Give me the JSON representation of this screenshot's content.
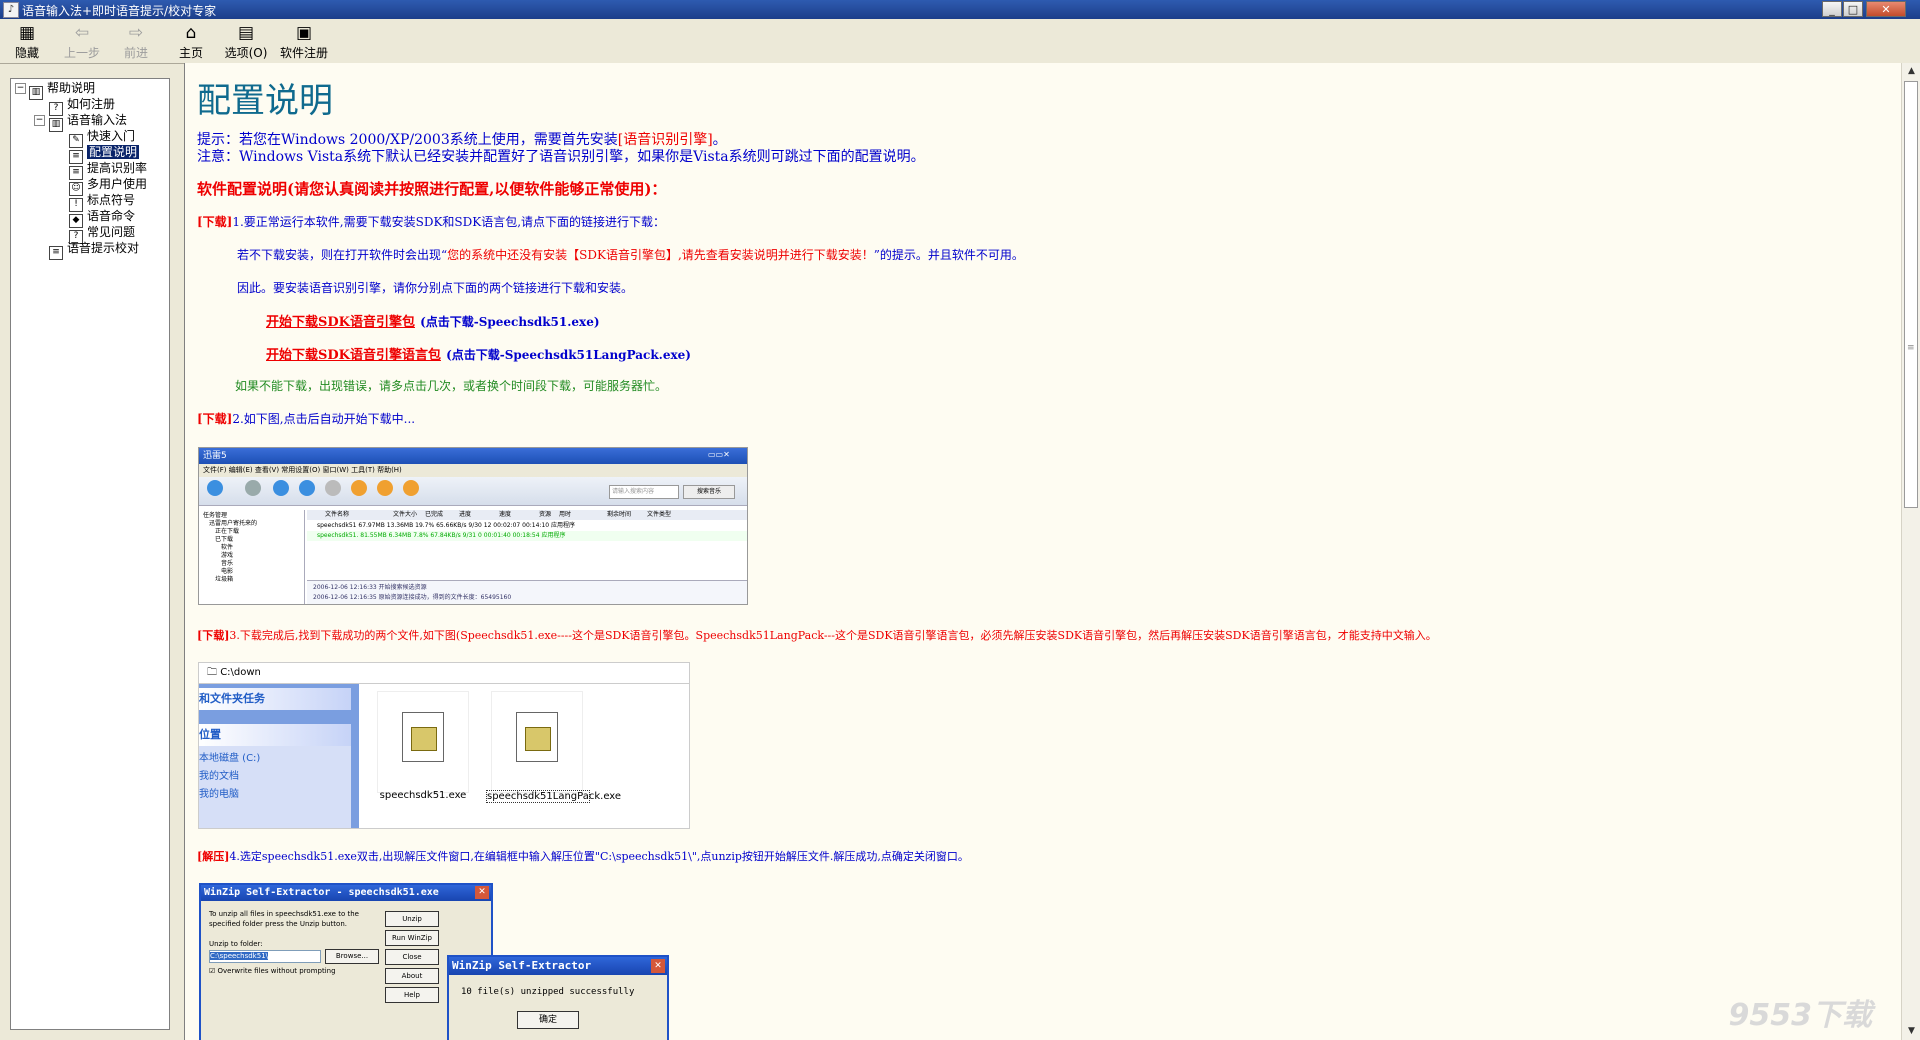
{
  "window": {
    "title": "语音输入法+即时语音提示/校对专家",
    "minimize": "_",
    "maximize": "□",
    "close": "✕"
  },
  "toolbar": {
    "hide": "隐藏",
    "back": "上一步",
    "forward": "前进",
    "home": "主页",
    "options": "选项(O)",
    "register": "软件注册"
  },
  "tree": {
    "root": "帮助说明",
    "howto_register": "如何注册",
    "voice_input": "语音输入法",
    "quick_start": "快速入门",
    "config": "配置说明",
    "improve": "提高识别率",
    "multiuser": "多用户使用",
    "punct": "标点符号",
    "commands": "语音命令",
    "faq": "常见问题",
    "proof": "语音提示校对"
  },
  "content": {
    "heading": "配置说明",
    "tip1_prefix": "提示：若您在Windows 2000/XP/2003系统上使用，需要首先安装",
    "tip1_link": "[语音识别引擎]",
    "tip1_suffix": "。",
    "tip2": "注意：Windows Vista系统下默认已经安装并配置好了语音识别引擎，如果你是Vista系统则可跳过下面的配置说明。",
    "section_title": "软件配置说明(请您认真阅读并按照进行配置,以便软件能够正常使用)：",
    "step1_tag": "[下载]",
    "step1_text": "1.要正常运行本软件,需要下载安装SDK和SDK语言包,请点下面的链接进行下载：",
    "step1_note_a": "若不下载安装，则在打开软件时会出现“",
    "step1_note_red": "您的系统中还没有安装【SDK语音引擎包】,请先查看安装说明并进行下载安装！",
    "step1_note_b": "”的提示。并且软件不可用。",
    "step1_note2": "因此。要安装语音识别引擎，请你分别点下面的两个链接进行下载和安装。",
    "link1": "开始下载SDK语音引擎包",
    "link1_hint": "(点击下载-Speechsdk51.exe)",
    "link2": "开始下载SDK语音引擎语言包",
    "link2_hint": "(点击下载-Speechsdk51LangPack.exe)",
    "retry_note": "如果不能下载，出现错误，请多点击几次，或者换个时间段下载，可能服务器忙。",
    "step2_tag": "[下载]",
    "step2_text": "2.如下图,点击后自动开始下载中...",
    "step3_tag": "[下载]",
    "step3_text": "3.下载完成后,找到下载成功的两个文件,如下图(Speechsdk51.exe----这个是SDK语音引擎包。Speechsdk51LangPack---这个是SDK语音引擎语言包，必须先解压安装SDK语音引擎包，然后再解压安装SDK语音引擎语言包，才能支持中文输入。",
    "step4_tag": "[解压]",
    "step4_text": "4.选定speechsdk51.exe双击,出现解压文件窗口,在编辑框中输入解压位置\"C:\\speechsdk51\\\",点unzip按钮开始解压文件.解压成功,点确定关闭窗口。"
  },
  "shot_xunlei": {
    "title": "迅雷5",
    "menu": "文件(F)  编辑(E)  查看(V)  常用设置(O)  窗口(W)  工具(T)  帮助(H)",
    "search_placeholder": "请输入搜索内容",
    "search_btn": "搜索音乐",
    "tree_root": "任务管理",
    "tree1": "迅雷用户寄托来的",
    "tree2": "正在下载",
    "tree3": "已下载",
    "tree4": "软件",
    "tree5": "游戏",
    "tree6": "音乐",
    "tree7": "电影",
    "tree8": "垃圾箱",
    "col_name": "文件名称",
    "col_size": "文件大小",
    "col_done": "已完成",
    "col_progress": "进度",
    "col_speed": "速度",
    "col_res": "资源",
    "col_time": "用时",
    "col_left": "剩余时间",
    "col_type": "文件类型",
    "row1": "speechsdk51  67.97MB  13.36MB  19.7%  65.66KB/s  9/30  12  00:02:07  00:14:10  应用程序",
    "row2": "speechsdk51.  81.55MB   6.34MB   7.8%  67.84KB/s  9/31  0   00:01:40  00:18:54  应用程序",
    "log1": "2006-12-06 12:16:33  开始搜索候选资源",
    "log2": "2006-12-06 12:16:35  原始资源连接成功，得到的文件长度：65495160"
  },
  "shot_folder": {
    "path": "C:\\down",
    "task": "和文件夹任务",
    "places": "位置",
    "disk": "本地磁盘 (C:)",
    "docs": "我的文档",
    "computer": "我的电脑",
    "file1": "speechsdk51.exe",
    "file2": "speechsdk51LangPack.exe"
  },
  "shot_winzip": {
    "title": "WinZip Self-Extractor - speechsdk51.exe",
    "desc1": "To unzip all files in speechsdk51.exe to the",
    "desc2": "specified folder press the Unzip button.",
    "label": "Unzip to folder:",
    "folder": "C:\\speechsdk51\\",
    "browse": "Browse...",
    "overwrite": "Overwrite files without prompting",
    "unzip": "Unzip",
    "run": "Run WinZip",
    "close": "Close",
    "about": "About",
    "help": "Help",
    "popup_title": "WinZip Self-Extractor",
    "popup_msg": "10 file(s) unzipped successfully",
    "popup_ok": "确定"
  },
  "watermark": "9553下载"
}
